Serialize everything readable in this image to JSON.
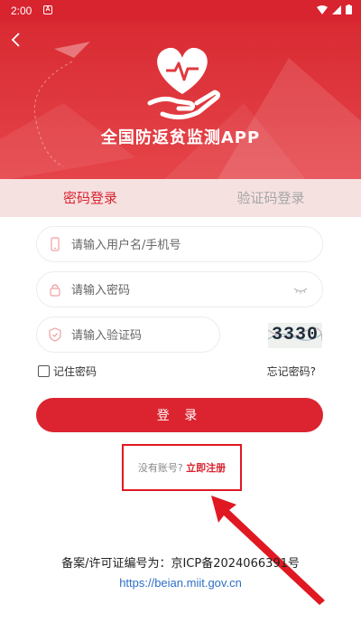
{
  "status_bar": {
    "time": "2:00",
    "notification_icon": "A"
  },
  "header": {
    "title": "全国防返贫监测APP",
    "logo": "heart-hand-logo",
    "accent": "#d8242f"
  },
  "tabs": [
    {
      "label": "密码登录",
      "active": true
    },
    {
      "label": "验证码登录",
      "active": false
    }
  ],
  "form": {
    "username": {
      "placeholder": "请输入用户名/手机号",
      "value": ""
    },
    "password": {
      "placeholder": "请输入密码",
      "value": ""
    },
    "captcha": {
      "placeholder": "请输入验证码",
      "value": "",
      "image_text": "3330"
    },
    "remember_label": "记住密码",
    "remember_checked": false,
    "forgot_label": "忘记密码?",
    "login_label": "登 录"
  },
  "register": {
    "prompt": "没有账号?",
    "link": "立即注册"
  },
  "footer": {
    "icp": "备案/许可证编号为：京ICP备2024066391号",
    "url": "https://beian.miit.gov.cn"
  },
  "colors": {
    "primary": "#d8242f",
    "tab_bg": "#f6e1e1",
    "link": "#2e6fc6"
  }
}
